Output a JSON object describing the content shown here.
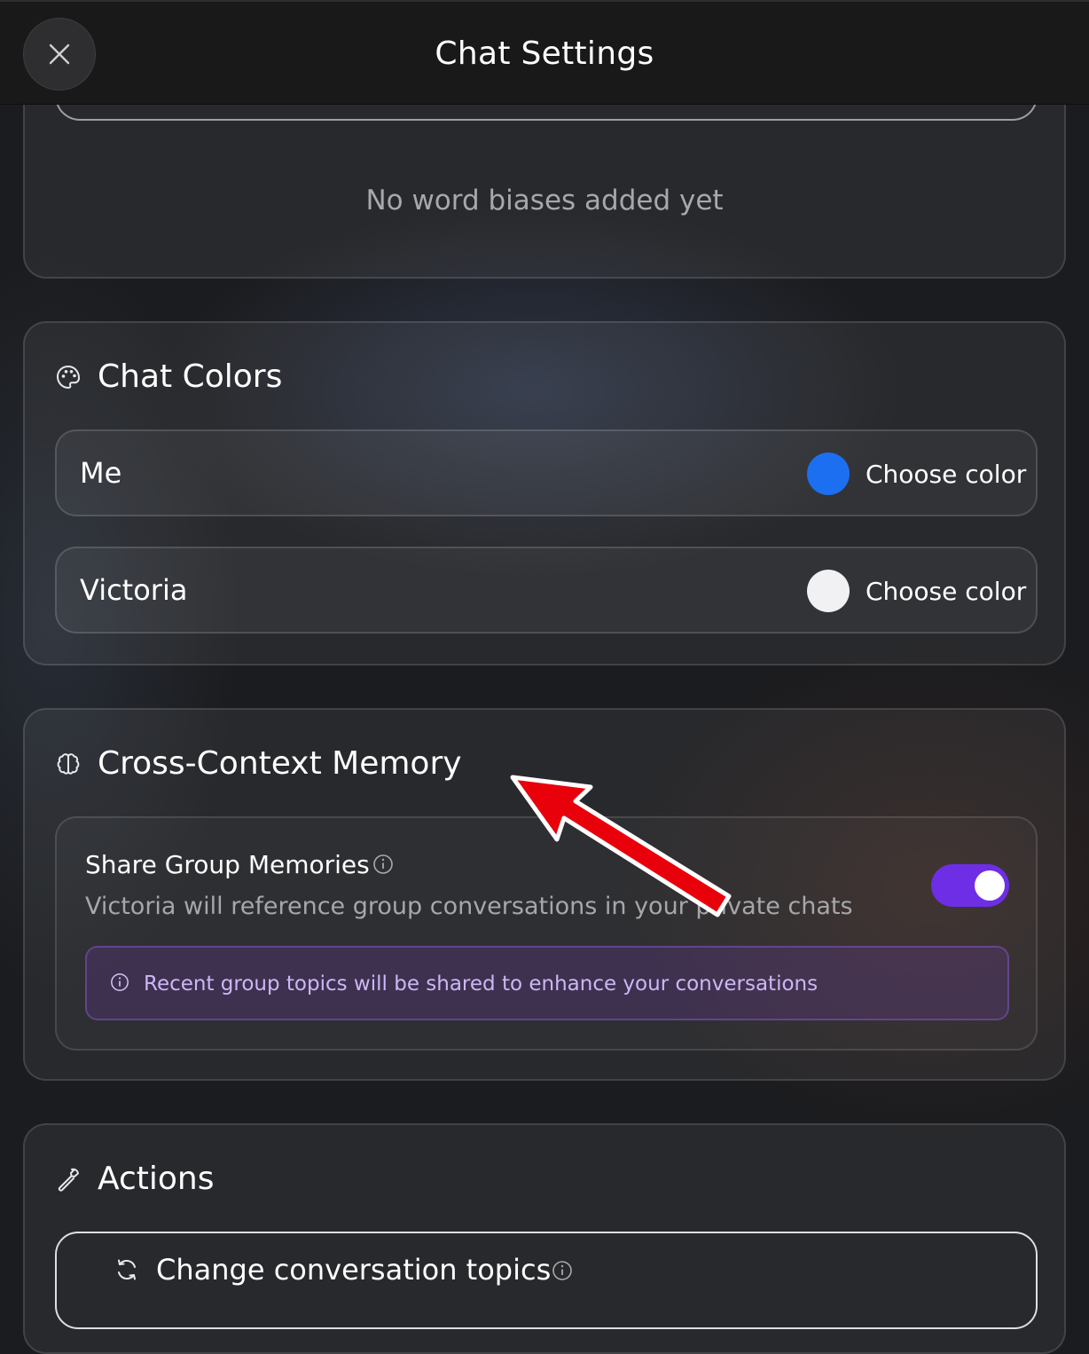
{
  "header": {
    "title": "Chat Settings",
    "close_icon": "close-icon"
  },
  "word_bias": {
    "empty_text": "No word biases added yet"
  },
  "chat_colors": {
    "title": "Chat Colors",
    "icon": "palette-icon",
    "rows": [
      {
        "name": "Me",
        "color": "#1d6ff2",
        "action": "Choose color"
      },
      {
        "name": "Victoria",
        "color": "#f1f1f3",
        "action": "Choose color"
      }
    ]
  },
  "memory": {
    "title": "Cross-Context Memory",
    "icon": "brain-icon",
    "setting_title": "Share Group Memories",
    "setting_desc": "Victoria will reference group conversations in your private chats",
    "toggle_on": true,
    "toggle_color": "#6d2ee6",
    "notice": "Recent group topics will be shared to enhance your conversations"
  },
  "actions": {
    "title": "Actions",
    "icon": "wrench-icon",
    "button_label": "Change conversation topics"
  },
  "annotation": {
    "arrow_color": "#e8000b"
  }
}
